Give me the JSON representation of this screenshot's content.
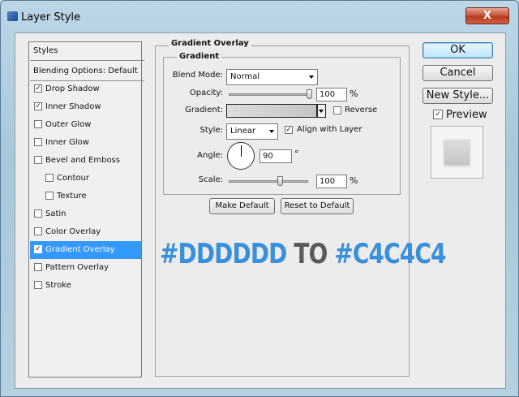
{
  "window": {
    "title": "Layer Style",
    "close_glyph": "X"
  },
  "styles_panel": {
    "header": "Styles",
    "blending_options": "Blending Options: Default",
    "items": [
      {
        "label": "Drop Shadow",
        "checked": true
      },
      {
        "label": "Inner Shadow",
        "checked": true
      },
      {
        "label": "Outer Glow",
        "checked": false
      },
      {
        "label": "Inner Glow",
        "checked": false
      },
      {
        "label": "Bevel and Emboss",
        "checked": false
      },
      {
        "label": "Contour",
        "checked": false
      },
      {
        "label": "Texture",
        "checked": false
      },
      {
        "label": "Satin",
        "checked": false
      },
      {
        "label": "Color Overlay",
        "checked": false
      },
      {
        "label": "Gradient Overlay",
        "checked": true,
        "selected": true
      },
      {
        "label": "Pattern Overlay",
        "checked": false
      },
      {
        "label": "Stroke",
        "checked": false
      }
    ]
  },
  "gradient_overlay": {
    "section_title": "Gradient Overlay",
    "group_title": "Gradient",
    "blend_mode_label": "Blend Mode:",
    "blend_mode_value": "Normal",
    "opacity_label": "Opacity:",
    "opacity_value": "100",
    "opacity_fraction": 1.0,
    "percent": "%",
    "gradient_label": "Gradient:",
    "reverse_label": "Reverse",
    "style_label": "Style:",
    "style_value": "Linear",
    "align_label": "Align with Layer",
    "angle_label": "Angle:",
    "angle_value": "90",
    "degree": "°",
    "scale_label": "Scale:",
    "scale_value": "100",
    "scale_fraction": 0.5,
    "gradient_colors": [
      "#dddddd",
      "#c4c4c4"
    ]
  },
  "buttons": {
    "make_default": "Make Default",
    "reset_default": "Reset to Default",
    "ok": "OK",
    "cancel": "Cancel",
    "new_style": "New Style...",
    "preview": "Preview"
  },
  "annotation": {
    "part1": "#DDDDDD",
    "part2": " TO ",
    "part3": "#C4C4C4",
    "color_blue": "#3a8fdc",
    "color_dark": "#5a5a5a"
  },
  "colors": {
    "selection": "#3399ff",
    "ok_border": "#3c7fb1"
  }
}
